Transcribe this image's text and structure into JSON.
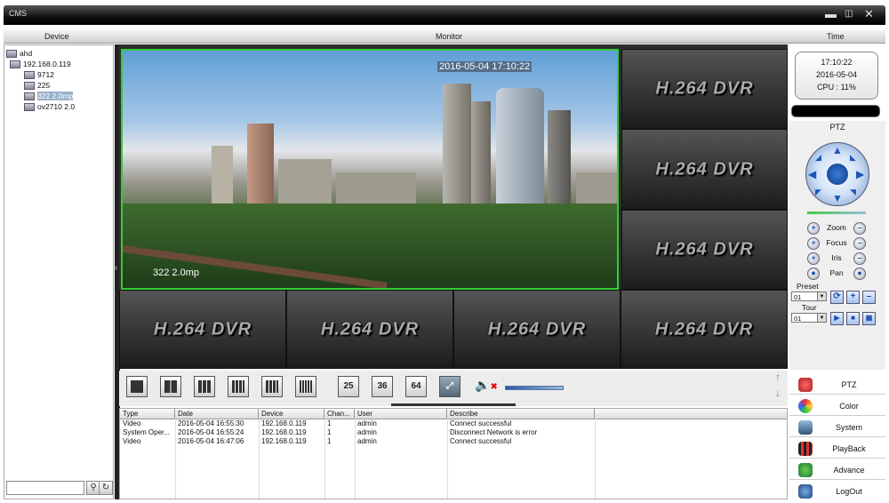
{
  "window": {
    "title": "CMS",
    "controls": [
      "minimize",
      "maximize",
      "close"
    ]
  },
  "header": {
    "device": "Device",
    "monitor": "Monitor",
    "time": "Time"
  },
  "tree": [
    {
      "label": "ahd",
      "level": 0
    },
    {
      "label": "192.168.0.119",
      "level": 1
    },
    {
      "label": "9712",
      "level": 2
    },
    {
      "label": "225",
      "level": 2
    },
    {
      "label": "322 2.0mp",
      "level": 2
    },
    {
      "label": "ov2710 2.0",
      "level": 2
    }
  ],
  "monitor": {
    "timestamp": "2016-05-04 17:10:22",
    "channel_name": "322 2.0mp",
    "placeholder": "H.264 DVR"
  },
  "toolbar": {
    "layouts": [
      "1",
      "4",
      "6",
      "8",
      "9",
      "16",
      "25",
      "36",
      "64"
    ]
  },
  "clock": {
    "time": "17:10:22",
    "date": "2016-05-04",
    "cpu": "CPU : 11%"
  },
  "ptz": {
    "title": "PTZ",
    "controls": [
      "Zoom",
      "Focus",
      "Iris",
      "Pan"
    ],
    "preset_label": "Preset",
    "preset_value": "01",
    "tour_label": "Tour",
    "tour_value": "01"
  },
  "menu": [
    "PTZ",
    "Color",
    "System",
    "PlayBack",
    "Advance",
    "LogOut"
  ],
  "log": {
    "columns": [
      "Type",
      "Date",
      "Device",
      "Chan...",
      "User",
      "Describe"
    ],
    "rows": [
      [
        "Video",
        "2016-05-04 16:55:30",
        "192.168.0.119",
        "1",
        "admin",
        "Connect successful"
      ],
      [
        "System Oper...",
        "2016-05-04 16:55:24",
        "192.168.0.119",
        "1",
        "admin",
        "Disconnect Network is error"
      ],
      [
        "Video",
        "2016-05-04 16:47:06",
        "192.168.0.119",
        "1",
        "admin",
        "Connect successful"
      ]
    ]
  },
  "colors": {
    "active_border": "#33cc33",
    "accent": "#1a56b8"
  }
}
